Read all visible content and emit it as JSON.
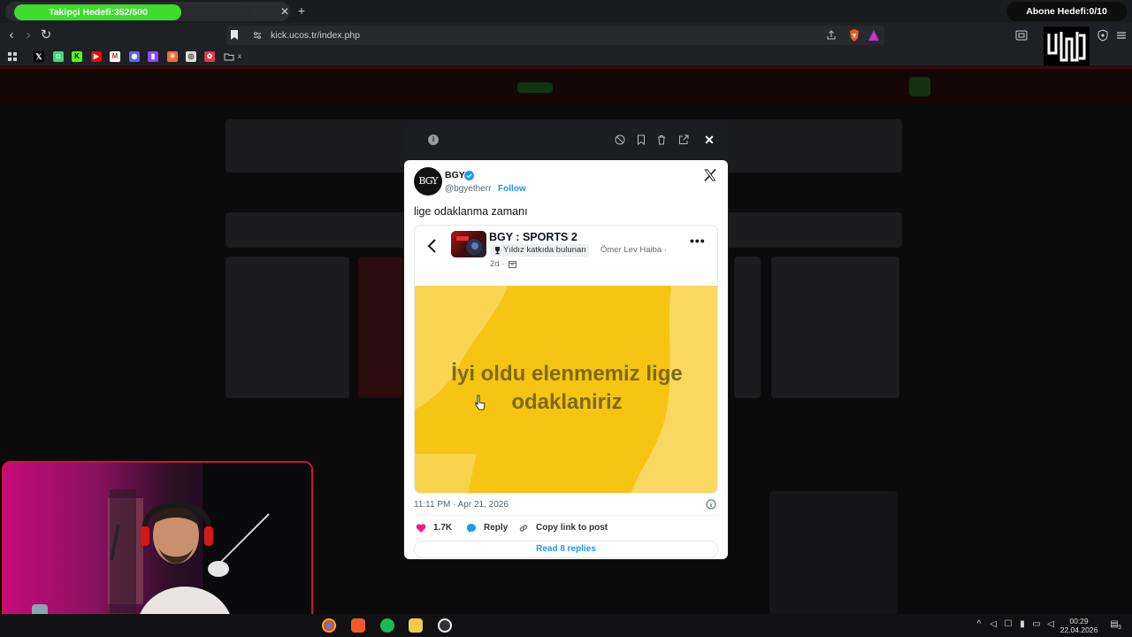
{
  "tabbar": {
    "tab_progress_label": "Takipçi Hedefi:352/500",
    "tab_progress_fraction": 0.704,
    "abone_label": "Abone Hedefi:0/10"
  },
  "toolbar": {
    "url": "kick.ucos.tr/index.php"
  },
  "bookmarks": {
    "folder_label": "x"
  },
  "tweet": {
    "author_avatar_text": "BGY",
    "author_name": "BGY",
    "author_handle": "@bgyetherr",
    "follow_label": "Follow",
    "text": "lige odaklanma zamanı",
    "embed": {
      "title": "BGY : SPORTS 2",
      "badge": "Yıldız katkıda bulunan",
      "author": "Ömer Lev Haiba ·",
      "time": "2d ·",
      "image_caption": "İyi oldu elenmemiz lige odaklaniriz"
    },
    "date": "11:11 PM · Apr 21, 2026",
    "likes": "1.7K",
    "reply_label": "Reply",
    "copy_label": "Copy link to post",
    "read_replies_label": "Read 8 replies"
  },
  "taskbar": {
    "time": "00:29",
    "date": "22.04.2026",
    "notif_count": "3"
  },
  "colors": {
    "progress_green": "#3ddc2f",
    "image_yellow": "#f6c513",
    "link_blue": "#1d9bf0",
    "webcam_border": "#d4103c"
  }
}
